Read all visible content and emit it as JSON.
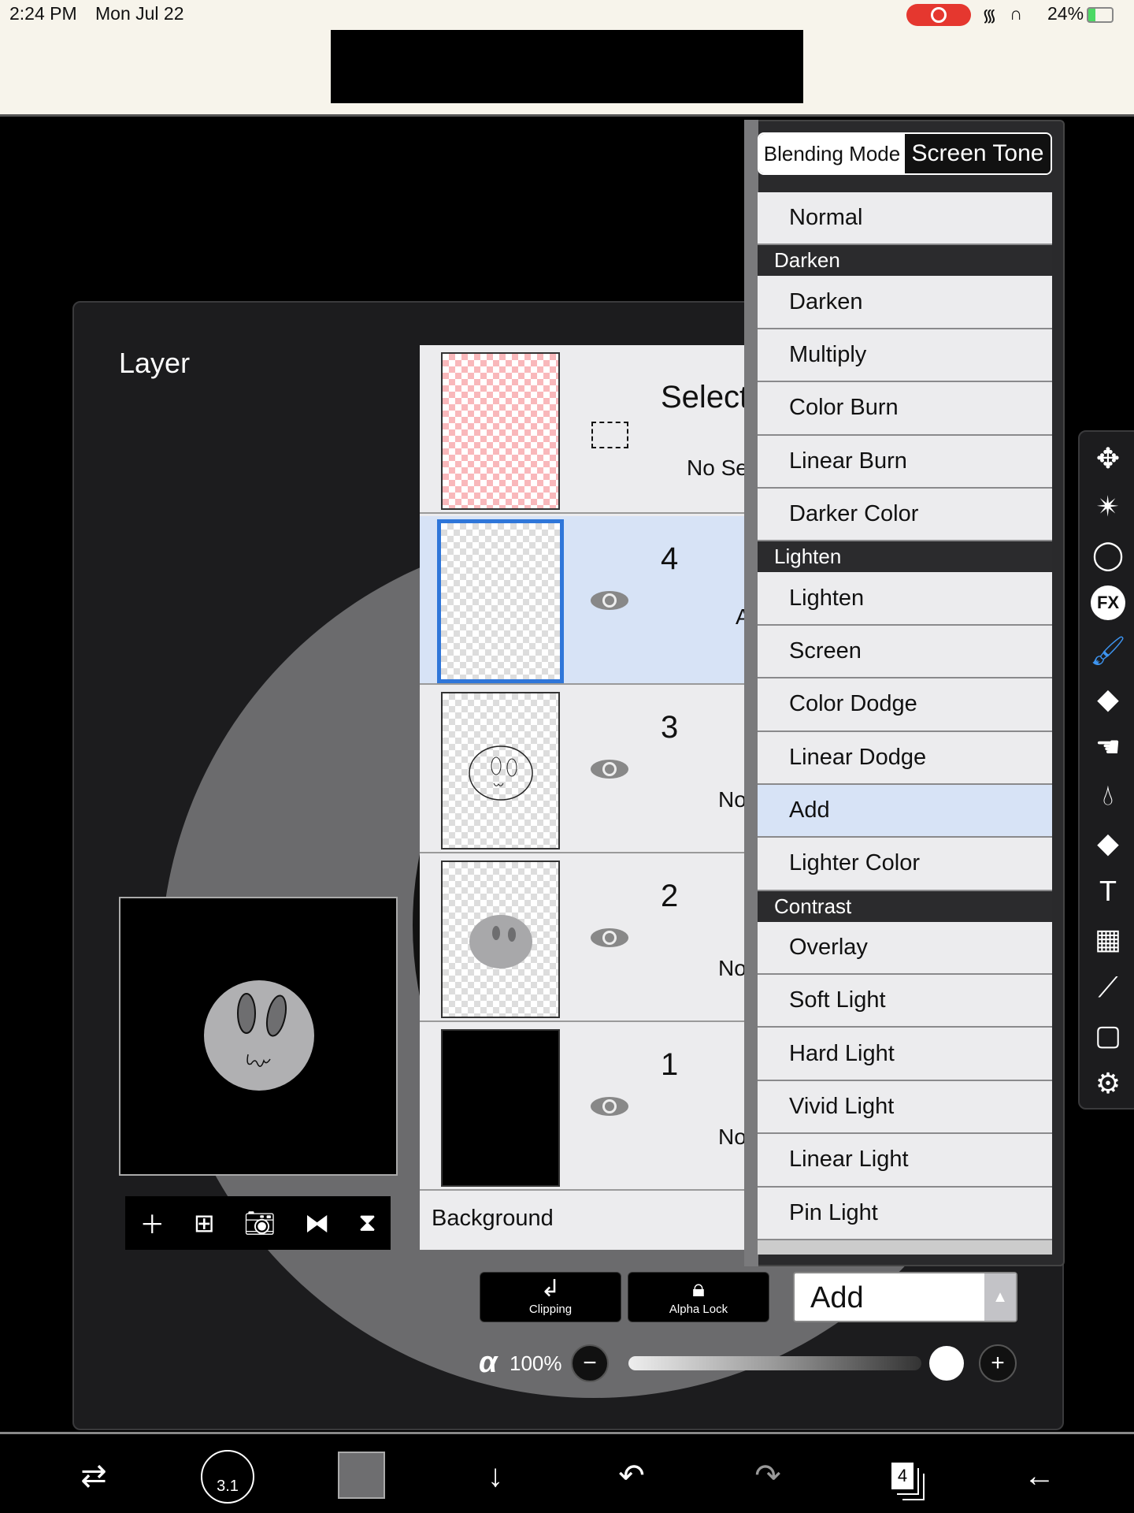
{
  "status_bar": {
    "time": "2:24 PM",
    "date": "Mon Jul 22",
    "battery": "24%",
    "icons": [
      "screen-record-icon",
      "wifi-icon",
      "headphones-icon",
      "battery-icon"
    ]
  },
  "panel": {
    "title": "Layer"
  },
  "layers": [
    {
      "name": "Select",
      "mode": "No Sel",
      "type": "selection"
    },
    {
      "name": "4",
      "mode": "Ad",
      "selected": true
    },
    {
      "name": "3",
      "mode": "Nor"
    },
    {
      "name": "2",
      "mode": "Nor"
    },
    {
      "name": "1",
      "mode": "Nor"
    }
  ],
  "background_label": "Background",
  "blend_menu": {
    "tabs": [
      "Blending Mode",
      "Screen Tone"
    ],
    "active_tab": "Blending Mode",
    "items": [
      {
        "label": "Normal"
      },
      {
        "label": "Darken",
        "header": true
      },
      {
        "label": "Darken"
      },
      {
        "label": "Multiply"
      },
      {
        "label": "Color Burn"
      },
      {
        "label": "Linear Burn"
      },
      {
        "label": "Darker Color"
      },
      {
        "label": "Lighten",
        "header": true
      },
      {
        "label": "Lighten"
      },
      {
        "label": "Screen"
      },
      {
        "label": "Color Dodge"
      },
      {
        "label": "Linear Dodge"
      },
      {
        "label": "Add",
        "selected": true
      },
      {
        "label": "Lighter Color"
      },
      {
        "label": "Contrast",
        "header": true
      },
      {
        "label": "Overlay"
      },
      {
        "label": "Soft Light"
      },
      {
        "label": "Hard Light"
      },
      {
        "label": "Vivid Light"
      },
      {
        "label": "Linear Light"
      },
      {
        "label": "Pin Light"
      }
    ]
  },
  "controls": {
    "clipping": "Clipping",
    "alpha_lock": "Alpha Lock",
    "blend_mode": "Add",
    "opacity_label": "100%",
    "opacity_value": 100
  },
  "bottom_bar": {
    "brush_size": "3.1",
    "layer_count": "4",
    "color": "#6e6e70"
  },
  "colors": {
    "accent": "#2f76d9",
    "selected_row": "#d7e3f6",
    "brush_tool": "#3d94f0",
    "record": "#e5372f"
  },
  "tools": [
    "move-icon",
    "magic-wand-icon",
    "lasso-icon",
    "fx-icon",
    "brush-icon",
    "eraser-icon",
    "smudge-icon",
    "blur-icon",
    "fill-icon",
    "text-icon",
    "frame-divider-icon",
    "eyedropper-icon",
    "canvas-icon",
    "settings-icon"
  ]
}
